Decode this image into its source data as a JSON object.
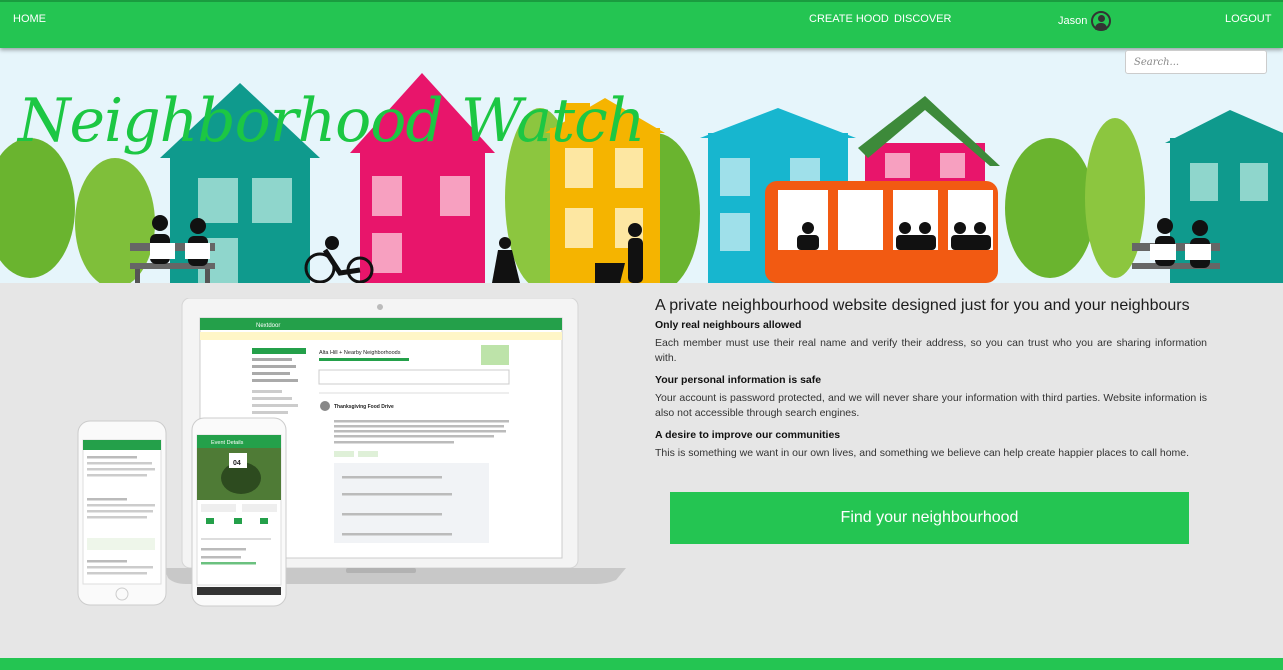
{
  "nav": {
    "home": "HOME",
    "create_hood": "CREATE HOOD",
    "discover": "DISCOVER",
    "user_name": "Jason",
    "logout": "LOGOUT"
  },
  "search": {
    "placeholder": "Search..."
  },
  "hero": {
    "title": "Neighborhood Watch"
  },
  "content": {
    "headline": "A private neighbourhood website designed just for you and your neighbours",
    "sections": [
      {
        "title": "Only real neighbours allowed",
        "text": "Each member must use their real name and verify their address, so you can trust who you are sharing information with."
      },
      {
        "title": "Your personal information is safe",
        "text": "Your account is password protected, and we will never share your information with third parties. Website information is also not accessible through search engines."
      },
      {
        "title": "A desire to improve our communities",
        "text": "This is something we want in our own lives, and something we believe can help create happier places to call home."
      }
    ],
    "cta": "Find your neighbourhood"
  },
  "mockup": {
    "app_name": "Nextdoor",
    "feed_title": "Alta Hill + Nearby Neighborhoods",
    "post_title": "Thanksgiving Food Drive",
    "event_label": "Event Details",
    "event_day": "04"
  },
  "colors": {
    "brand": "#24c552",
    "title_green": "#1cc743"
  }
}
